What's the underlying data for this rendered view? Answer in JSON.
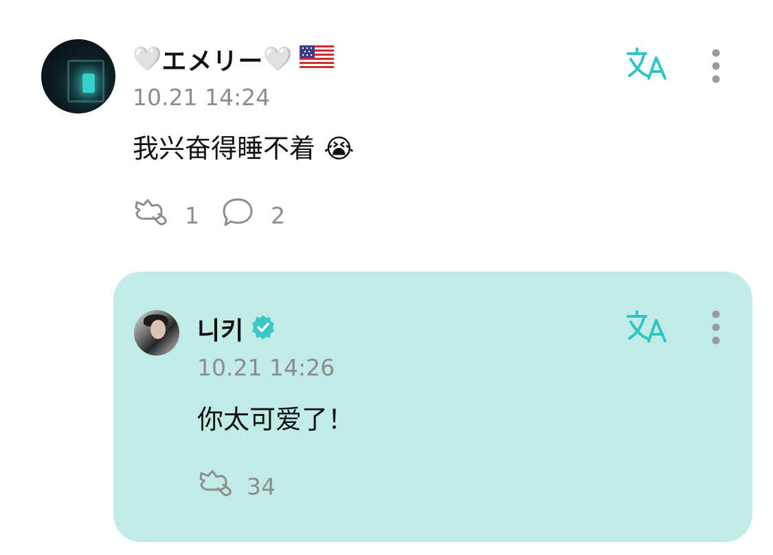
{
  "post": {
    "author": {
      "heart": "🤍",
      "name": "エメリー",
      "flag_icon": "us-flag-icon"
    },
    "timestamp": "10.21 14:24",
    "text": "我兴奋得睡不着 😭",
    "likes": "1",
    "comments": "2"
  },
  "reply": {
    "author": {
      "name": "니키",
      "verified_icon": "verified-badge-icon"
    },
    "timestamp": "10.21 14:26",
    "text": "你太可爱了！",
    "likes": "34"
  },
  "colors": {
    "accent": "#2ec5c3",
    "reply_bg": "#c0ece5",
    "muted": "#8c8c8c",
    "text": "#111111"
  }
}
